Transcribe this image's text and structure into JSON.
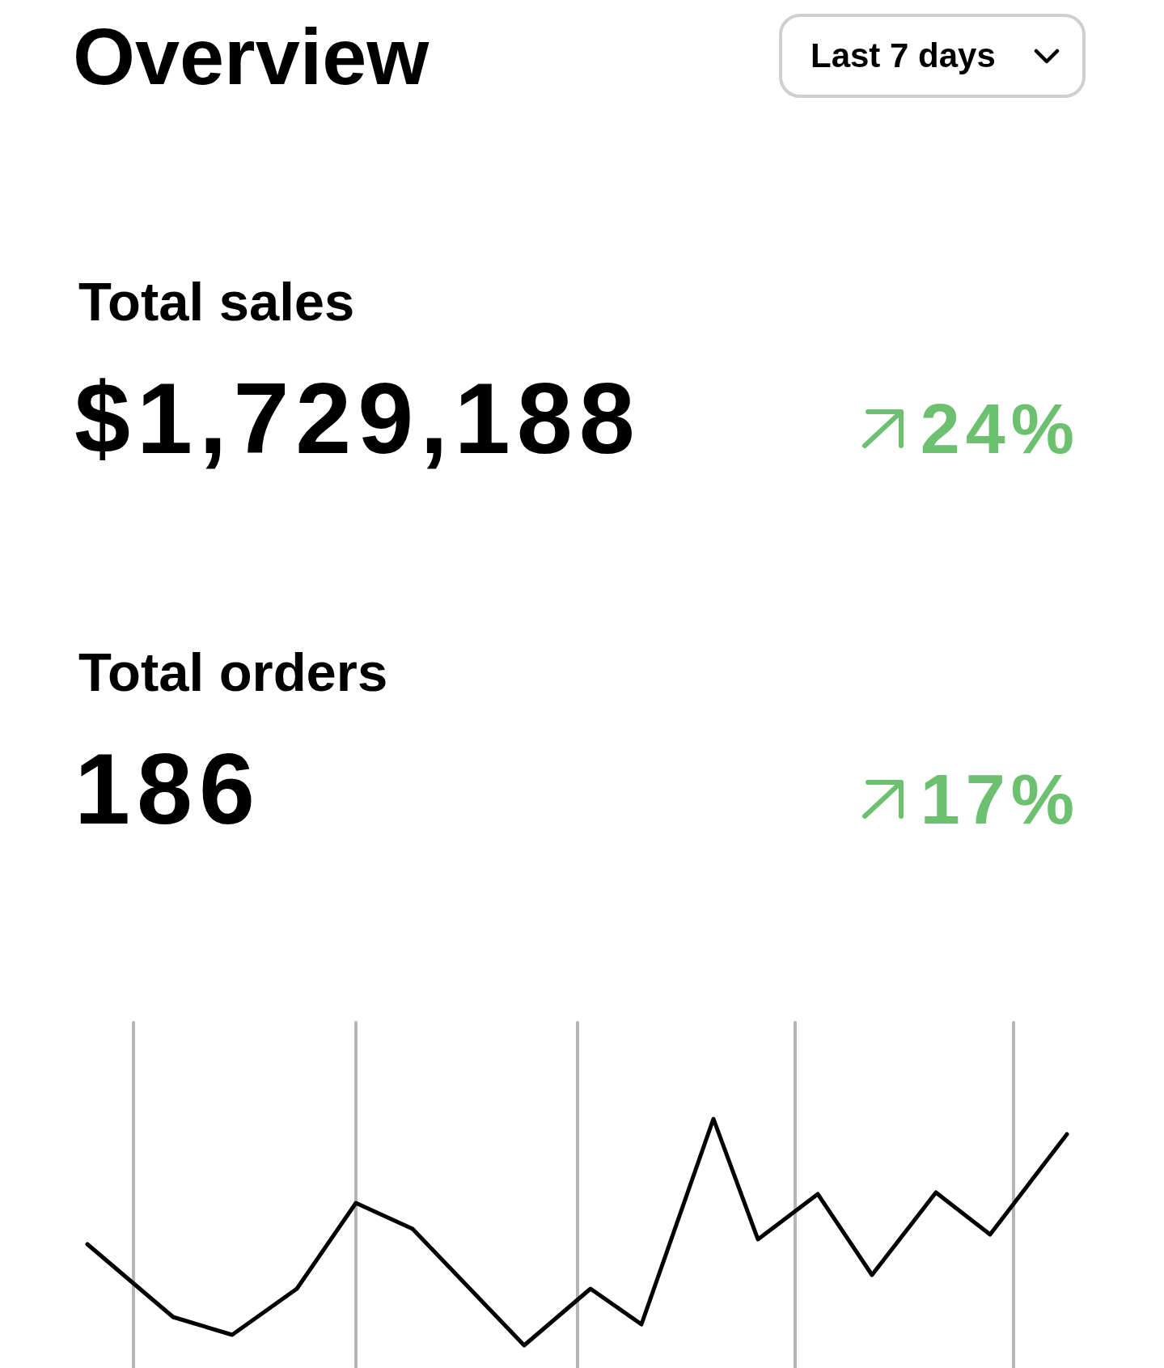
{
  "header": {
    "title": "Overview",
    "period_dropdown": {
      "value": "Last 7 days"
    }
  },
  "stats": [
    {
      "label": "Total sales",
      "value": "$1,729,188",
      "change": {
        "text": "24%",
        "increase": true
      }
    },
    {
      "label": "Total orders",
      "value": "186",
      "change": {
        "text": "17%",
        "increase": true
      }
    }
  ]
}
